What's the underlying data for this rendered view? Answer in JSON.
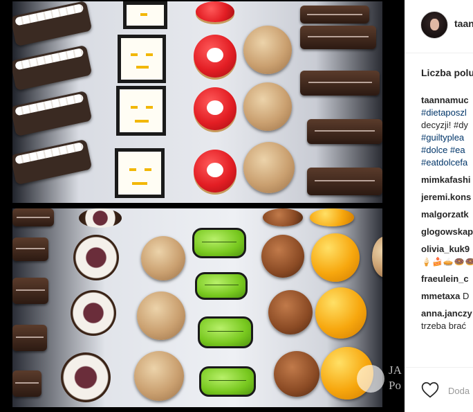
{
  "post": {
    "username": "taan",
    "likes_label": "Liczba polu"
  },
  "caption": {
    "user": "taannamuc",
    "lines": [
      "#dietaposzl",
      "decyzji! #dy",
      "#guiltyplea",
      "#dolce #ea",
      "#eatdolcefa"
    ]
  },
  "comments": [
    {
      "user": "mimkafashi",
      "text": ""
    },
    {
      "user": "jeremi.kons",
      "text": ""
    },
    {
      "user": "malgorzatk",
      "text": ""
    },
    {
      "user": "glogowskap",
      "text": ""
    },
    {
      "user": "olivia_kuk9",
      "text": "",
      "emoji": "🍦🍰🥧🍩🍩"
    },
    {
      "user": "fraeulein_c",
      "text": ""
    },
    {
      "user": "mmetaxa",
      "text": " D"
    },
    {
      "user": "anna.janczy",
      "text": "trzeba brać"
    }
  ],
  "actions": {
    "add_comment_placeholder": "Doda"
  },
  "watermark": {
    "line1": "JA",
    "line2": "Po"
  },
  "colors": {
    "link": "#003569",
    "text": "#262626",
    "muted": "#999999"
  }
}
